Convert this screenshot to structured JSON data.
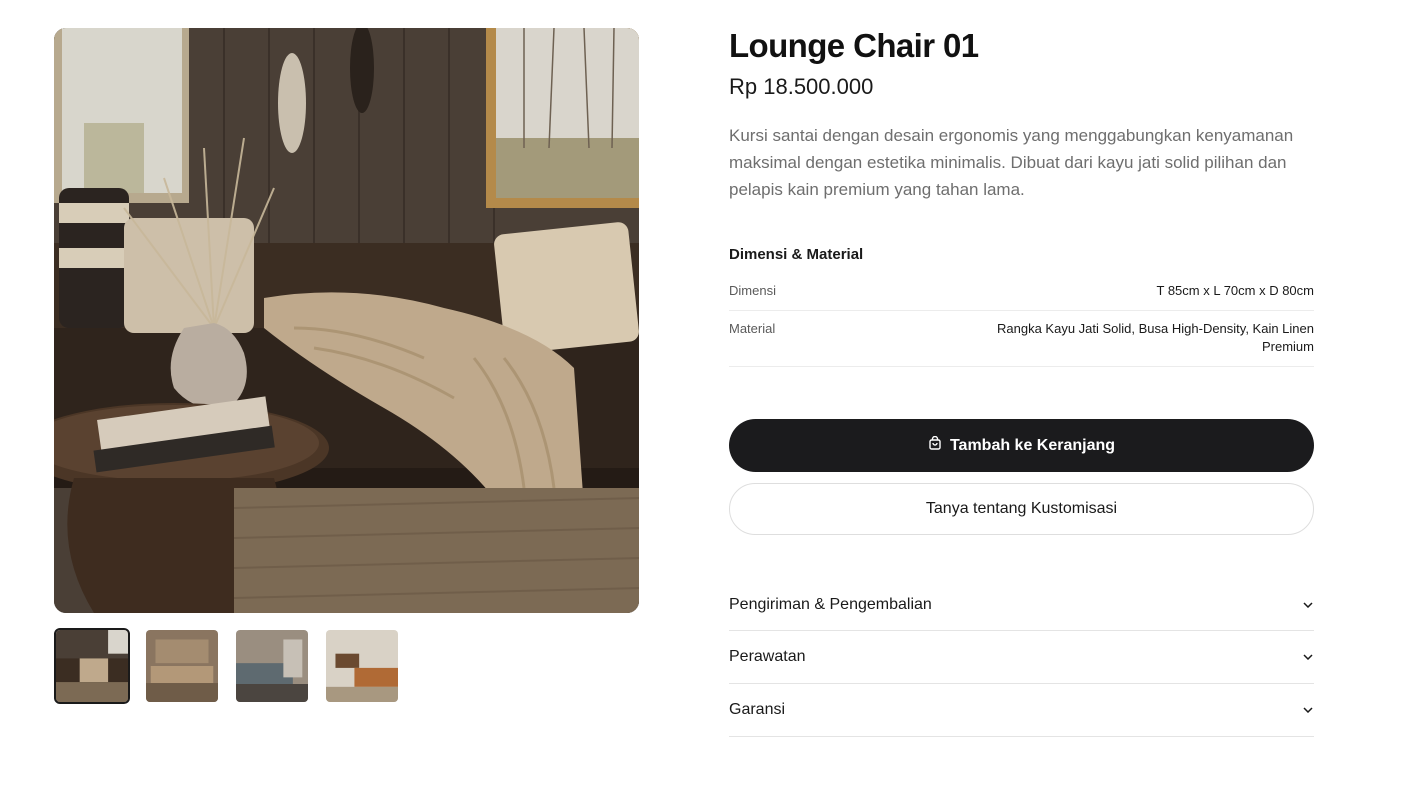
{
  "product": {
    "title": "Lounge Chair 01",
    "price": "Rp 18.500.000",
    "description": "Kursi santai dengan desain ergonomis yang menggabungkan kenyamanan maksimal dengan estetika minimalis. Dibuat dari kayu jati solid pilihan dan pelapis kain premium yang tahan lama."
  },
  "gallery": {
    "main_image": "living-room-sofa-photo",
    "thumbnails": [
      "thumb-living-room-1",
      "thumb-living-room-2",
      "thumb-living-room-3",
      "thumb-living-room-4"
    ],
    "active_thumbnail": 1
  },
  "specs": {
    "heading": "Dimensi & Material",
    "rows": [
      {
        "label": "Dimensi",
        "value": "T 85cm x L 70cm x D 80cm"
      },
      {
        "label": "Material",
        "value": "Rangka Kayu Jati Solid, Busa High-Density, Kain Linen Premium"
      }
    ]
  },
  "actions": {
    "add_to_cart_label": "Tambah ke Keranjang",
    "add_to_cart_icon": "shopping-bag-icon",
    "customize_label": "Tanya tentang Kustomisasi"
  },
  "accordion": {
    "items": [
      {
        "label": "Pengiriman & Pengembalian",
        "icon": "chevron-down-icon"
      },
      {
        "label": "Perawatan",
        "icon": "chevron-down-icon"
      },
      {
        "label": "Garansi",
        "icon": "chevron-down-icon"
      }
    ]
  },
  "colors": {
    "primary_button": "#1b1b1d",
    "text_muted": "#6e6e6e",
    "divider": "#e4e4e4"
  }
}
